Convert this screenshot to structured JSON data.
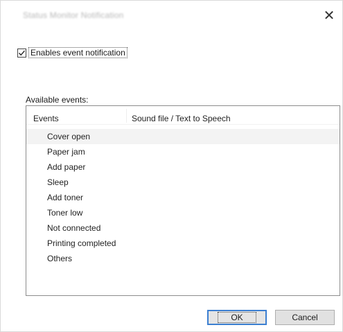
{
  "window": {
    "title": "Status Monitor Notification",
    "close_glyph": "✕"
  },
  "enable": {
    "label": "Enables event notification",
    "checked": true
  },
  "events_group": {
    "label": "Available events:"
  },
  "list": {
    "columns": [
      "Events",
      "Sound file / Text to Speech"
    ],
    "rows": [
      "Cover open",
      "Paper jam",
      "Add paper",
      "Sleep",
      "Add toner",
      "Toner low",
      "Not connected",
      "Printing completed",
      "Others"
    ],
    "selected_index": 0
  },
  "buttons": {
    "ok_label": "OK",
    "cancel_label": "Cancel"
  },
  "colors": {
    "ok_focus_border": "#3c7fd1",
    "button_face": "#e1e1e1",
    "selected_row": "#f3f3f3"
  },
  "icons": {
    "close": "close-icon",
    "check": "checkmark-icon"
  }
}
